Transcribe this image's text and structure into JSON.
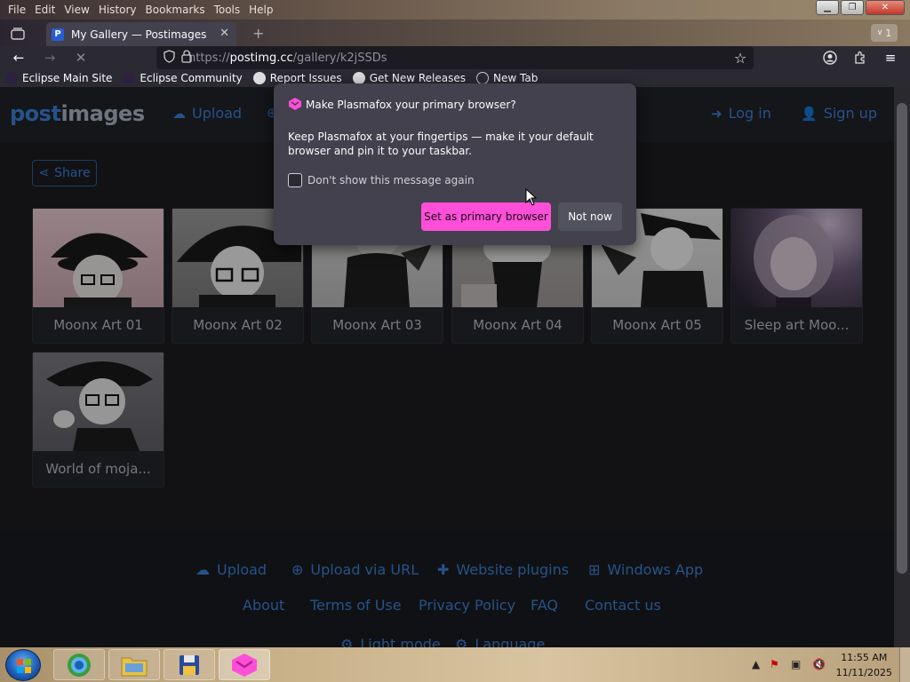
{
  "menubar": {
    "items": [
      "File",
      "Edit",
      "View",
      "History",
      "Bookmarks",
      "Tools",
      "Help"
    ],
    "accel": [
      "F",
      "E",
      "V",
      "s",
      "B",
      "T",
      "H"
    ]
  },
  "tab": {
    "title": "My Gallery — Postimages",
    "favicon": "P",
    "count": "1"
  },
  "url": {
    "prefix": "https://",
    "domain": "postimg.cc",
    "path": "/gallery/k2jSSDs"
  },
  "bookmarks": [
    {
      "label": "Eclipse Main Site",
      "icon": "eclipse-icon"
    },
    {
      "label": "Eclipse Community",
      "icon": "eclipse-icon"
    },
    {
      "label": "Report Issues",
      "icon": "github-icon"
    },
    {
      "label": "Get New Releases",
      "icon": "github-icon"
    },
    {
      "label": "New Tab",
      "icon": "globe-icon"
    }
  ],
  "site": {
    "logo_post": "post",
    "logo_images": "images",
    "upload": "Upload",
    "login": "Log in",
    "signup": "Sign up",
    "share": "Share"
  },
  "gallery": [
    {
      "caption": "Moonx Art 01"
    },
    {
      "caption": "Moonx Art 02"
    },
    {
      "caption": "Moonx Art 03"
    },
    {
      "caption": "Moonx Art 04"
    },
    {
      "caption": "Moonx Art 05"
    },
    {
      "caption": "Sleep art Moo..."
    },
    {
      "caption": "World of moja..."
    }
  ],
  "footer": {
    "upload": "Upload",
    "upload_url": "Upload via URL",
    "plugins": "Website plugins",
    "windows_app": "Windows App",
    "about": "About",
    "terms": "Terms of Use",
    "privacy": "Privacy Policy",
    "faq": "FAQ",
    "contact": "Contact us",
    "light_mode": "Light mode",
    "language": "Language"
  },
  "popup": {
    "title": "Make Plasmafox your primary browser?",
    "body": "Keep Plasmafox at your fingertips — make it your default browser and pin it to your taskbar.",
    "checkbox_label": "Don't show this message again",
    "primary_button": "Set as primary browser",
    "secondary_button": "Not now",
    "accent": "#ff4fd8"
  },
  "taskbar": {
    "time": "11:55 AM",
    "date": "11/11/2025"
  },
  "colors": {
    "link_blue": "#3b7fd4",
    "popup_bg": "#42414d"
  }
}
